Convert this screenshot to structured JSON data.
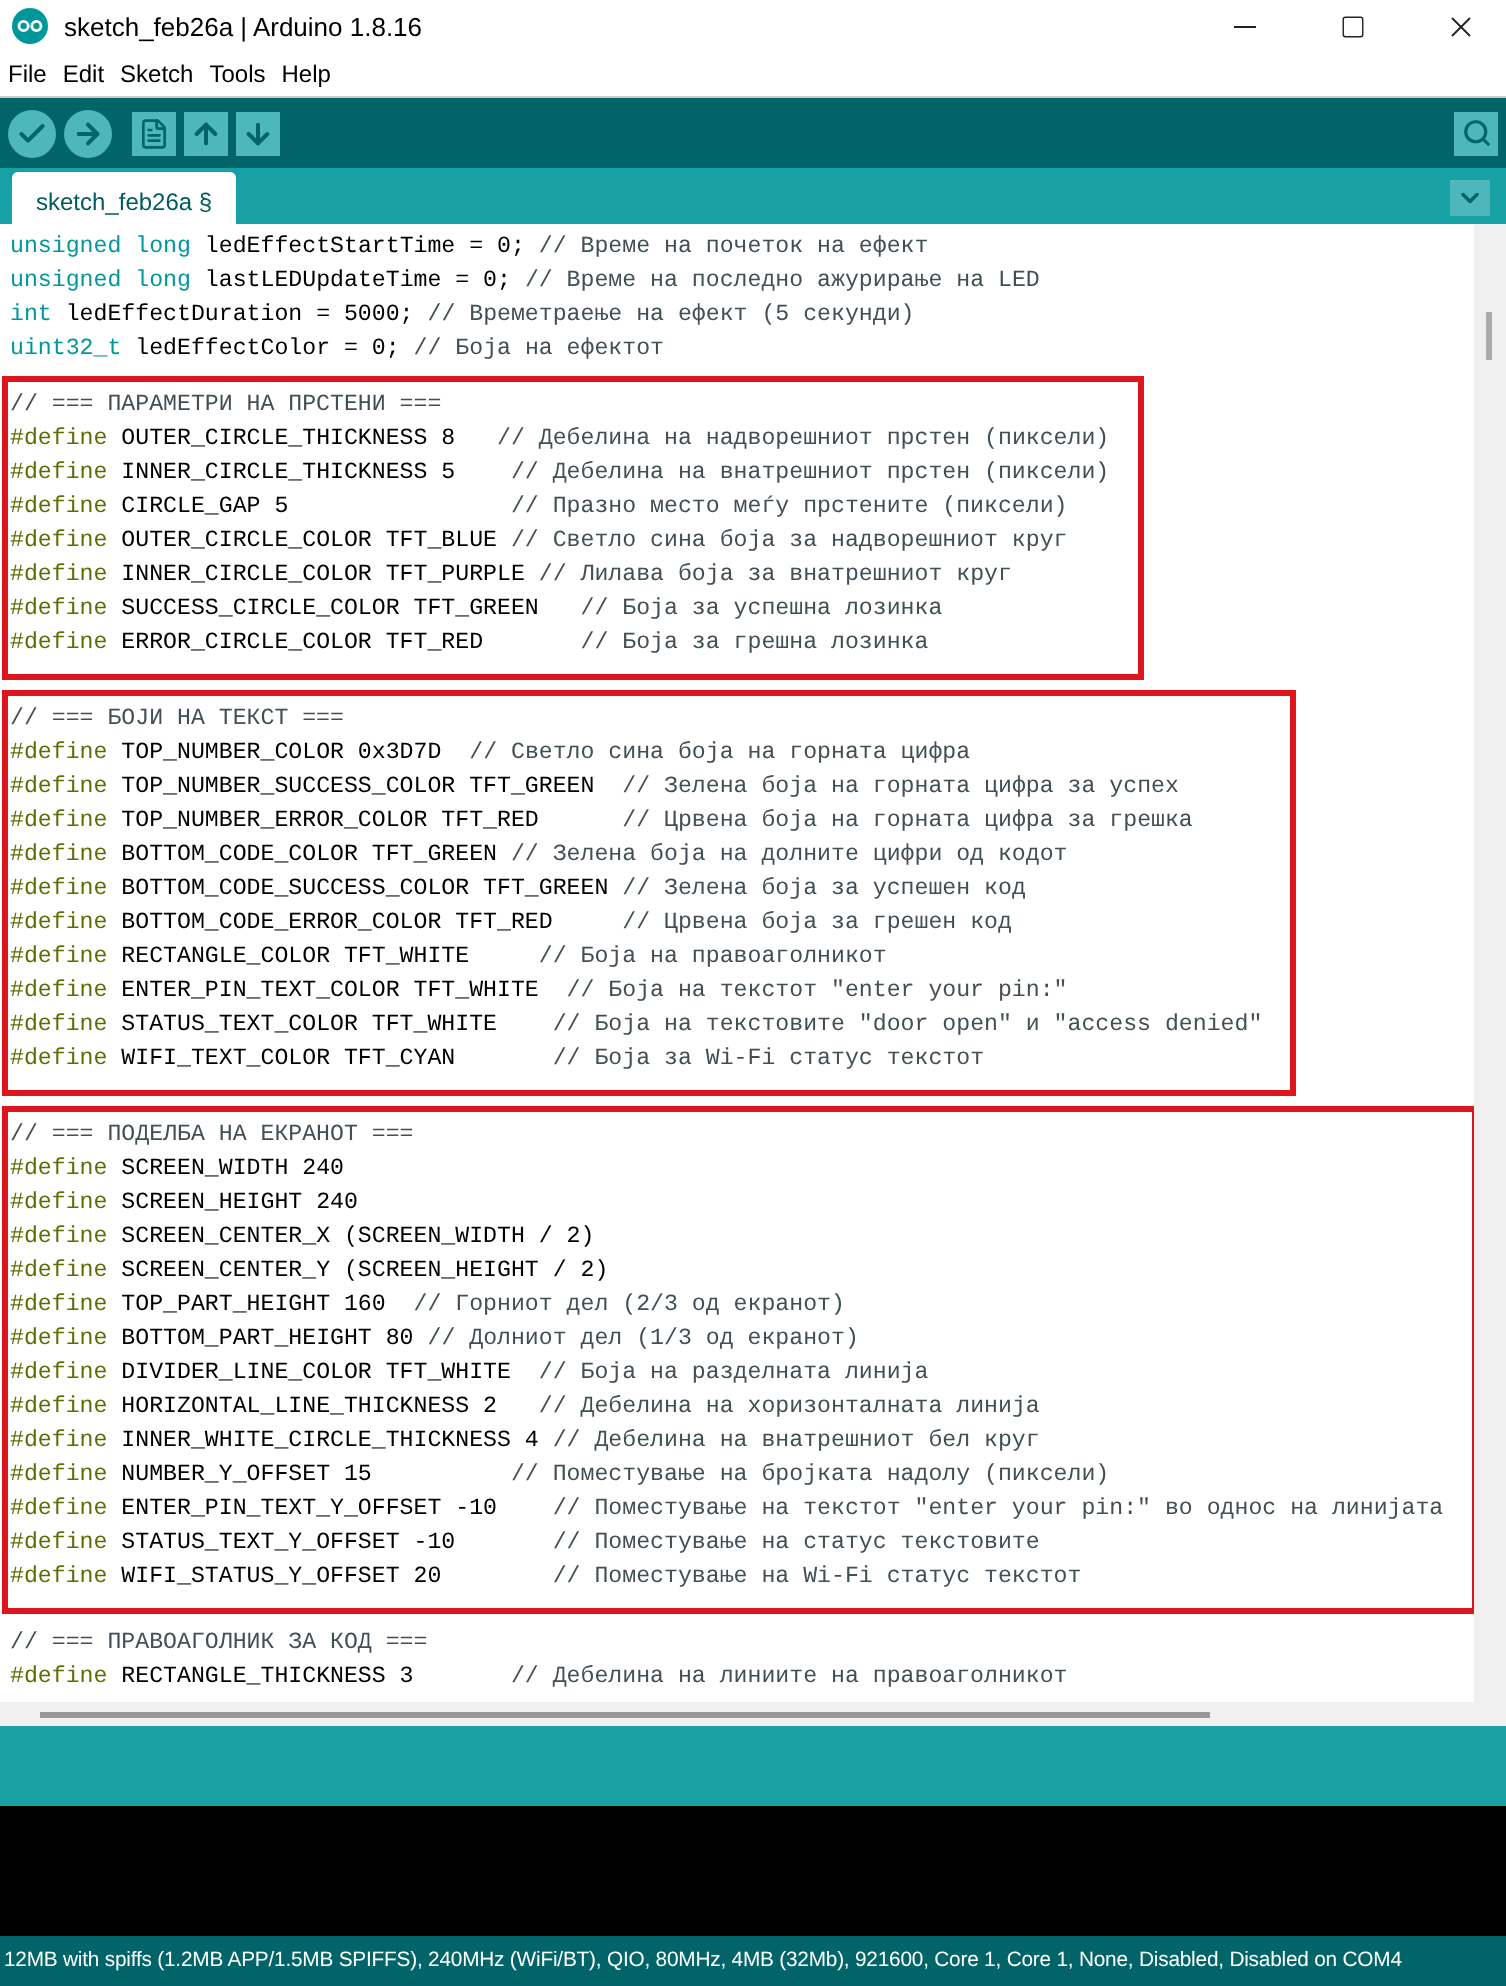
{
  "window": {
    "title": "sketch_feb26a | Arduino 1.8.16"
  },
  "menu": [
    "File",
    "Edit",
    "Sketch",
    "Tools",
    "Help"
  ],
  "tabs": [
    {
      "label": "sketch_feb26a §",
      "selected": true
    }
  ],
  "sections": [
    {
      "highlighted": false,
      "lines": [
        [
          {
            "kind": "keyword",
            "text": "unsigned long"
          },
          {
            "kind": "plain",
            "text": " ledEffectStartTime = 0; "
          },
          {
            "kind": "comment",
            "text": "// Време на почеток на ефект"
          }
        ],
        [
          {
            "kind": "keyword",
            "text": "unsigned long"
          },
          {
            "kind": "plain",
            "text": " lastLEDUpdateTime = 0; "
          },
          {
            "kind": "comment",
            "text": "// Време на последно ажурирање на LED"
          }
        ],
        [
          {
            "kind": "keyword",
            "text": "int"
          },
          {
            "kind": "plain",
            "text": " ledEffectDuration = 5000; "
          },
          {
            "kind": "comment",
            "text": "// Времетраење на ефект (5 секунди)"
          }
        ],
        [
          {
            "kind": "keyword",
            "text": "uint32_t"
          },
          {
            "kind": "plain",
            "text": " ledEffectColor = 0; "
          },
          {
            "kind": "comment",
            "text": "// Боја на ефектот"
          }
        ]
      ]
    },
    {
      "highlighted": true,
      "lines": [
        [
          {
            "kind": "comment",
            "text": "// === ПАРАМЕТРИ НА ПРСТЕНИ ==="
          }
        ],
        [
          {
            "kind": "directive",
            "text": "#define"
          },
          {
            "kind": "plain",
            "text": " OUTER_CIRCLE_THICKNESS 8   "
          },
          {
            "kind": "comment",
            "text": "// Дебелина на надворешниот прстен (пиксели)"
          }
        ],
        [
          {
            "kind": "directive",
            "text": "#define"
          },
          {
            "kind": "plain",
            "text": " INNER_CIRCLE_THICKNESS 5    "
          },
          {
            "kind": "comment",
            "text": "// Дебелина на внатрешниот прстен (пиксели)"
          }
        ],
        [
          {
            "kind": "directive",
            "text": "#define"
          },
          {
            "kind": "plain",
            "text": " CIRCLE_GAP 5                "
          },
          {
            "kind": "comment",
            "text": "// Празно место меѓу прстените (пиксели)"
          }
        ],
        [
          {
            "kind": "directive",
            "text": "#define"
          },
          {
            "kind": "plain",
            "text": " OUTER_CIRCLE_COLOR TFT_BLUE "
          },
          {
            "kind": "comment",
            "text": "// Светло сина боја за надворешниот круг"
          }
        ],
        [
          {
            "kind": "directive",
            "text": "#define"
          },
          {
            "kind": "plain",
            "text": " INNER_CIRCLE_COLOR TFT_PURPLE "
          },
          {
            "kind": "comment",
            "text": "// Лилава боја за внатрешниот круг"
          }
        ],
        [
          {
            "kind": "directive",
            "text": "#define"
          },
          {
            "kind": "plain",
            "text": " SUCCESS_CIRCLE_COLOR TFT_GREEN   "
          },
          {
            "kind": "comment",
            "text": "// Боја за успешна лозинка"
          }
        ],
        [
          {
            "kind": "directive",
            "text": "#define"
          },
          {
            "kind": "plain",
            "text": " ERROR_CIRCLE_COLOR TFT_RED       "
          },
          {
            "kind": "comment",
            "text": "// Боја за грешна лозинка"
          }
        ]
      ]
    },
    {
      "highlighted": true,
      "lines": [
        [
          {
            "kind": "comment",
            "text": "// === БОЈИ НА ТЕКСТ ==="
          }
        ],
        [
          {
            "kind": "directive",
            "text": "#define"
          },
          {
            "kind": "plain",
            "text": " TOP_NUMBER_COLOR 0x3D7D  "
          },
          {
            "kind": "comment",
            "text": "// Светло сина боја на горната цифра"
          }
        ],
        [
          {
            "kind": "directive",
            "text": "#define"
          },
          {
            "kind": "plain",
            "text": " TOP_NUMBER_SUCCESS_COLOR TFT_GREEN  "
          },
          {
            "kind": "comment",
            "text": "// Зелена боја на горната цифра за успех"
          }
        ],
        [
          {
            "kind": "directive",
            "text": "#define"
          },
          {
            "kind": "plain",
            "text": " TOP_NUMBER_ERROR_COLOR TFT_RED      "
          },
          {
            "kind": "comment",
            "text": "// Црвена боја на горната цифра за грешка"
          }
        ],
        [
          {
            "kind": "directive",
            "text": "#define"
          },
          {
            "kind": "plain",
            "text": " BOTTOM_CODE_COLOR TFT_GREEN "
          },
          {
            "kind": "comment",
            "text": "// Зелена боја на долните цифри од кодот"
          }
        ],
        [
          {
            "kind": "directive",
            "text": "#define"
          },
          {
            "kind": "plain",
            "text": " BOTTOM_CODE_SUCCESS_COLOR TFT_GREEN "
          },
          {
            "kind": "comment",
            "text": "// Зелена боја за успешен код"
          }
        ],
        [
          {
            "kind": "directive",
            "text": "#define"
          },
          {
            "kind": "plain",
            "text": " BOTTOM_CODE_ERROR_COLOR TFT_RED     "
          },
          {
            "kind": "comment",
            "text": "// Црвена боја за грешен код"
          }
        ],
        [
          {
            "kind": "directive",
            "text": "#define"
          },
          {
            "kind": "plain",
            "text": " RECTANGLE_COLOR TFT_WHITE     "
          },
          {
            "kind": "comment",
            "text": "// Боја на правоаголникот"
          }
        ],
        [
          {
            "kind": "directive",
            "text": "#define"
          },
          {
            "kind": "plain",
            "text": " ENTER_PIN_TEXT_COLOR TFT_WHITE  "
          },
          {
            "kind": "comment",
            "text": "// Боја на текстот \"enter your pin:\""
          }
        ],
        [
          {
            "kind": "directive",
            "text": "#define"
          },
          {
            "kind": "plain",
            "text": " STATUS_TEXT_COLOR TFT_WHITE    "
          },
          {
            "kind": "comment",
            "text": "// Боја на текстовите \"door open\" и \"access denied\""
          }
        ],
        [
          {
            "kind": "directive",
            "text": "#define"
          },
          {
            "kind": "plain",
            "text": " WIFI_TEXT_COLOR TFT_CYAN       "
          },
          {
            "kind": "comment",
            "text": "// Боја за Wi-Fi статус текстот"
          }
        ]
      ]
    },
    {
      "highlighted": true,
      "lines": [
        [
          {
            "kind": "comment",
            "text": "// === ПОДЕЛБА НА ЕКРАНОТ ==="
          }
        ],
        [
          {
            "kind": "directive",
            "text": "#define"
          },
          {
            "kind": "plain",
            "text": " SCREEN_WIDTH 240"
          }
        ],
        [
          {
            "kind": "directive",
            "text": "#define"
          },
          {
            "kind": "plain",
            "text": " SCREEN_HEIGHT 240"
          }
        ],
        [
          {
            "kind": "directive",
            "text": "#define"
          },
          {
            "kind": "plain",
            "text": " SCREEN_CENTER_X (SCREEN_WIDTH / 2)"
          }
        ],
        [
          {
            "kind": "directive",
            "text": "#define"
          },
          {
            "kind": "plain",
            "text": " SCREEN_CENTER_Y (SCREEN_HEIGHT / 2)"
          }
        ],
        [
          {
            "kind": "directive",
            "text": "#define"
          },
          {
            "kind": "plain",
            "text": " TOP_PART_HEIGHT 160  "
          },
          {
            "kind": "comment",
            "text": "// Горниот дел (2/3 од екранот)"
          }
        ],
        [
          {
            "kind": "directive",
            "text": "#define"
          },
          {
            "kind": "plain",
            "text": " BOTTOM_PART_HEIGHT 80 "
          },
          {
            "kind": "comment",
            "text": "// Долниот дел (1/3 од екранот)"
          }
        ],
        [
          {
            "kind": "directive",
            "text": "#define"
          },
          {
            "kind": "plain",
            "text": " DIVIDER_LINE_COLOR TFT_WHITE  "
          },
          {
            "kind": "comment",
            "text": "// Боја на разделната линија"
          }
        ],
        [
          {
            "kind": "directive",
            "text": "#define"
          },
          {
            "kind": "plain",
            "text": " HORIZONTAL_LINE_THICKNESS 2   "
          },
          {
            "kind": "comment",
            "text": "// Дебелина на хоризонталната линија"
          }
        ],
        [
          {
            "kind": "directive",
            "text": "#define"
          },
          {
            "kind": "plain",
            "text": " INNER_WHITE_CIRCLE_THICKNESS 4 "
          },
          {
            "kind": "comment",
            "text": "// Дебелина на внатрешниот бел круг"
          }
        ],
        [
          {
            "kind": "directive",
            "text": "#define"
          },
          {
            "kind": "plain",
            "text": " NUMBER_Y_OFFSET 15          "
          },
          {
            "kind": "comment",
            "text": "// Поместување на бројката надолу (пиксели)"
          }
        ],
        [
          {
            "kind": "directive",
            "text": "#define"
          },
          {
            "kind": "plain",
            "text": " ENTER_PIN_TEXT_Y_OFFSET -10    "
          },
          {
            "kind": "comment",
            "text": "// Поместување на текстот \"enter your pin:\" во однос на линијата"
          }
        ],
        [
          {
            "kind": "directive",
            "text": "#define"
          },
          {
            "kind": "plain",
            "text": " STATUS_TEXT_Y_OFFSET -10       "
          },
          {
            "kind": "comment",
            "text": "// Поместување на статус текстовите"
          }
        ],
        [
          {
            "kind": "directive",
            "text": "#define"
          },
          {
            "kind": "plain",
            "text": " WIFI_STATUS_Y_OFFSET 20        "
          },
          {
            "kind": "comment",
            "text": "// Поместување на Wi-Fi статус текстот"
          }
        ]
      ]
    },
    {
      "highlighted": false,
      "lines": [
        [
          {
            "kind": "comment",
            "text": "// === ПРАВОАГОЛНИК ЗА КОД ==="
          }
        ],
        [
          {
            "kind": "directive",
            "text": "#define"
          },
          {
            "kind": "plain",
            "text": " RECTANGLE_THICKNESS 3       "
          },
          {
            "kind": "comment",
            "text": "// Дебелина на линиите на правоаголникот"
          }
        ]
      ]
    }
  ],
  "status_bar": "12MB with spiffs (1.2MB APP/1.5MB SPIFFS), 240MHz (WiFi/BT), QIO, 80MHz, 4MB (32Mb), 921600, Core 1, Core 1, None, Disabled, Disabled on COM4"
}
